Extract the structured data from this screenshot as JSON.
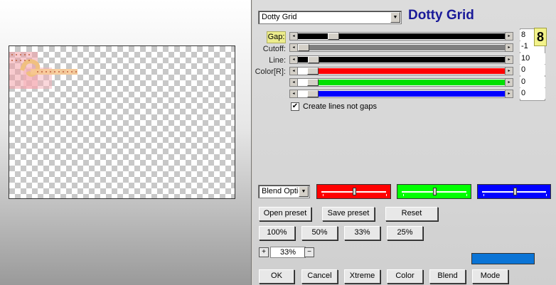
{
  "filter": {
    "dropdown_value": "Dotty Grid",
    "title": "Dotty Grid"
  },
  "params": [
    {
      "label": "Gap:",
      "value": "8",
      "value_fraction": 0.15,
      "track_color": "#000000"
    },
    {
      "label": "Cutoff:",
      "value": "-1",
      "value_fraction": 0.0,
      "track_color": "#808080"
    },
    {
      "label": "Line:",
      "value": "10",
      "value_fraction": 0.05,
      "track_color": "#000000"
    },
    {
      "label": "Color[R]:",
      "value": "0",
      "value_fraction": 0.0,
      "track_color": "#ff0000"
    },
    {
      "label": "",
      "value": "0",
      "value_fraction": 0.0,
      "track_color": "#00e000"
    },
    {
      "label": "",
      "value": "0",
      "value_fraction": 0.0,
      "track_color": "#0000ff"
    }
  ],
  "gap_badge": "8",
  "option": {
    "checked": true,
    "label": "Create lines not gaps"
  },
  "blend": {
    "dropdown_value": "Blend Optio",
    "swatches": [
      {
        "color": "#ff0000",
        "level": 0.5
      },
      {
        "color": "#00ff00",
        "level": 0.5
      },
      {
        "color": "#0000ff",
        "level": 0.5
      }
    ]
  },
  "buttons": {
    "open_preset": "Open preset",
    "save_preset": "Save preset",
    "reset": "Reset",
    "zoom_100": "100%",
    "zoom_50": "50%",
    "zoom_33": "33%",
    "zoom_25": "25%",
    "zoom_plus": "+",
    "zoom_minus": "−",
    "zoom_value": "33%",
    "ok": "OK",
    "cancel": "Cancel",
    "xtreme": "Xtreme",
    "color": "Color",
    "blend": "Blend",
    "mode": "Mode"
  },
  "colors": {
    "title": "#1a1a99",
    "preview_swatch": "#0a74d6"
  }
}
